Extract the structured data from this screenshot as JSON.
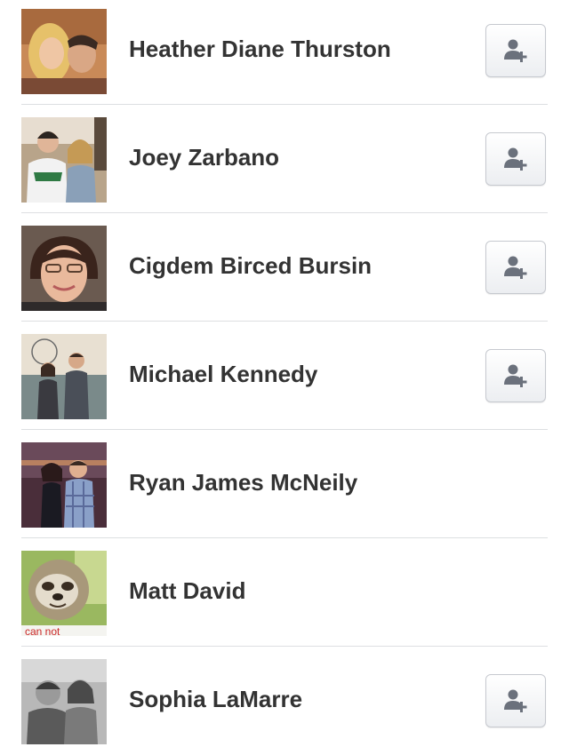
{
  "colors": {
    "name_text": "#333333",
    "divider": "#dddfe2",
    "button_border": "#c6c9cf",
    "button_icon": "#6b717c"
  },
  "people": [
    {
      "name": "Heather Diane Thurston",
      "avatar": "profile-photo",
      "has_add_button": true,
      "add_icon": "add-friend-icon"
    },
    {
      "name": "Joey Zarbano",
      "avatar": "profile-photo",
      "has_add_button": true,
      "add_icon": "add-friend-icon"
    },
    {
      "name": "Cigdem Birced Bursin",
      "avatar": "profile-photo",
      "has_add_button": true,
      "add_icon": "add-friend-icon"
    },
    {
      "name": "Michael Kennedy",
      "avatar": "profile-photo",
      "has_add_button": true,
      "add_icon": "add-friend-icon"
    },
    {
      "name": "Ryan James McNeily",
      "avatar": "profile-photo",
      "has_add_button": false
    },
    {
      "name": "Matt David",
      "avatar": "profile-photo",
      "has_add_button": false
    },
    {
      "name": "Sophia LaMarre",
      "avatar": "profile-photo",
      "has_add_button": true,
      "add_icon": "add-friend-icon"
    }
  ]
}
